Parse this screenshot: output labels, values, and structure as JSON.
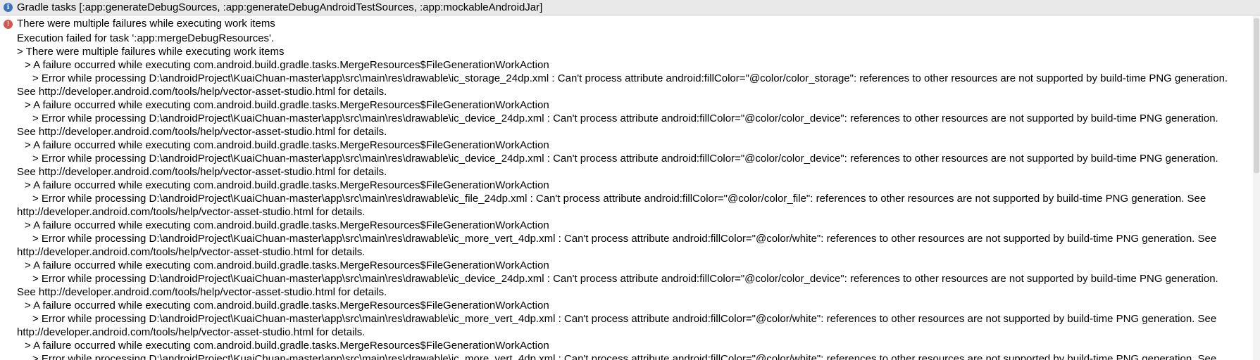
{
  "header": {
    "title": "Gradle tasks [:app:generateDebugSources, :app:generateDebugAndroidTestSources, :app:mockableAndroidJar]",
    "icon": "info-icon"
  },
  "error_title": "There were multiple failures while executing work items",
  "lines": [
    {
      "text": "Execution failed for task ':app:mergeDebugResources'.",
      "level": "l0"
    },
    {
      "text": "> There were multiple failures while executing work items",
      "level": "l1"
    },
    {
      "text": "> A failure occurred while executing com.android.build.gradle.tasks.MergeResources$FileGenerationWorkAction",
      "level": "l2"
    },
    {
      "text": "> Error while processing D:\\androidProject\\KuaiChuan-master\\app\\src\\main\\res\\drawable\\ic_storage_24dp.xml : Can't process attribute android:fillColor=\"@color/color_storage\": references to other resources are not supported by build-time PNG generation.",
      "level": "l3"
    },
    {
      "text": "See http://developer.android.com/tools/help/vector-asset-studio.html for details.",
      "level": "l0"
    },
    {
      "text": "> A failure occurred while executing com.android.build.gradle.tasks.MergeResources$FileGenerationWorkAction",
      "level": "l2"
    },
    {
      "text": "> Error while processing D:\\androidProject\\KuaiChuan-master\\app\\src\\main\\res\\drawable\\ic_device_24dp.xml : Can't process attribute android:fillColor=\"@color/color_device\": references to other resources are not supported by build-time PNG generation.",
      "level": "l3"
    },
    {
      "text": "See http://developer.android.com/tools/help/vector-asset-studio.html for details.",
      "level": "l0"
    },
    {
      "text": "> A failure occurred while executing com.android.build.gradle.tasks.MergeResources$FileGenerationWorkAction",
      "level": "l2"
    },
    {
      "text": "> Error while processing D:\\androidProject\\KuaiChuan-master\\app\\src\\main\\res\\drawable\\ic_device_24dp.xml : Can't process attribute android:fillColor=\"@color/color_device\": references to other resources are not supported by build-time PNG generation.",
      "level": "l3"
    },
    {
      "text": "See http://developer.android.com/tools/help/vector-asset-studio.html for details.",
      "level": "l0"
    },
    {
      "text": "> A failure occurred while executing com.android.build.gradle.tasks.MergeResources$FileGenerationWorkAction",
      "level": "l2"
    },
    {
      "text": "> Error while processing D:\\androidProject\\KuaiChuan-master\\app\\src\\main\\res\\drawable\\ic_file_24dp.xml : Can't process attribute android:fillColor=\"@color/color_file\": references to other resources are not supported by build-time PNG generation. See",
      "level": "l3"
    },
    {
      "text": "http://developer.android.com/tools/help/vector-asset-studio.html for details.",
      "level": "l0"
    },
    {
      "text": "> A failure occurred while executing com.android.build.gradle.tasks.MergeResources$FileGenerationWorkAction",
      "level": "l2"
    },
    {
      "text": "> Error while processing D:\\androidProject\\KuaiChuan-master\\app\\src\\main\\res\\drawable\\ic_more_vert_4dp.xml : Can't process attribute android:fillColor=\"@color/white\": references to other resources are not supported by build-time PNG generation. See",
      "level": "l3"
    },
    {
      "text": "http://developer.android.com/tools/help/vector-asset-studio.html for details.",
      "level": "l0"
    },
    {
      "text": "> A failure occurred while executing com.android.build.gradle.tasks.MergeResources$FileGenerationWorkAction",
      "level": "l2"
    },
    {
      "text": "> Error while processing D:\\androidProject\\KuaiChuan-master\\app\\src\\main\\res\\drawable\\ic_device_24dp.xml : Can't process attribute android:fillColor=\"@color/color_device\": references to other resources are not supported by build-time PNG generation.",
      "level": "l3"
    },
    {
      "text": "See http://developer.android.com/tools/help/vector-asset-studio.html for details.",
      "level": "l0"
    },
    {
      "text": "> A failure occurred while executing com.android.build.gradle.tasks.MergeResources$FileGenerationWorkAction",
      "level": "l2"
    },
    {
      "text": "> Error while processing D:\\androidProject\\KuaiChuan-master\\app\\src\\main\\res\\drawable\\ic_more_vert_4dp.xml : Can't process attribute android:fillColor=\"@color/white\": references to other resources are not supported by build-time PNG generation. See",
      "level": "l3"
    },
    {
      "text": "http://developer.android.com/tools/help/vector-asset-studio.html for details.",
      "level": "l0"
    },
    {
      "text": "> A failure occurred while executing com.android.build.gradle.tasks.MergeResources$FileGenerationWorkAction",
      "level": "l2"
    },
    {
      "text": "> Error while processing D:\\androidProject\\KuaiChuan-master\\app\\src\\main\\res\\drawable\\ic_more_vert_4dp.xml : Can't process attribute android:fillColor=\"@color/white\": references to other resources are not supported by build-time PNG generation. See",
      "level": "l3"
    }
  ],
  "colors": {
    "header_bg": "#e9e9e9",
    "info_icon": "#3b74c2",
    "error_icon": "#d9534f"
  }
}
